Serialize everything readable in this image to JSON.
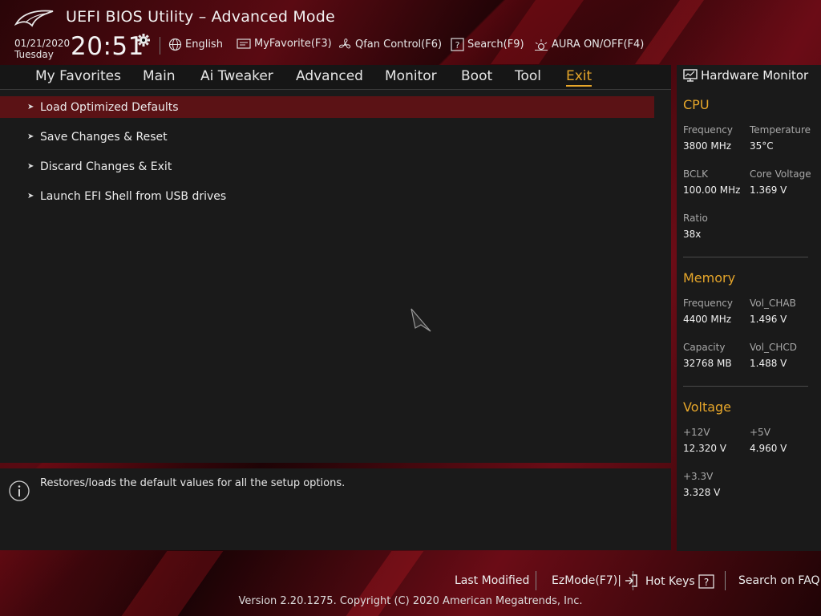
{
  "header": {
    "title": "UEFI BIOS Utility – Advanced Mode",
    "date": "01/21/2020",
    "day": "Tuesday",
    "time": "20:51",
    "tools": [
      {
        "label": "English",
        "icon": "globe-icon"
      },
      {
        "label": "MyFavorite(F3)",
        "icon": "favorite-icon"
      },
      {
        "label": "Qfan Control(F6)",
        "icon": "fan-icon"
      },
      {
        "label": "Search(F9)",
        "icon": "search-help-icon"
      },
      {
        "label": "AURA ON/OFF(F4)",
        "icon": "aura-icon"
      }
    ]
  },
  "tabs": [
    "My Favorites",
    "Main",
    "Ai Tweaker",
    "Advanced",
    "Monitor",
    "Boot",
    "Tool",
    "Exit"
  ],
  "active_tab": "Exit",
  "menu_items": [
    "Load Optimized Defaults",
    "Save Changes & Reset",
    "Discard Changes & Exit",
    "Launch EFI Shell from USB drives"
  ],
  "help_text": "Restores/loads the default values for all the setup options.",
  "hardware_monitor": {
    "title": "Hardware Monitor",
    "cpu": {
      "heading": "CPU",
      "frequency_label": "Frequency",
      "frequency": "3800 MHz",
      "temperature_label": "Temperature",
      "temperature": "35°C",
      "bclk_label": "BCLK",
      "bclk": "100.00 MHz",
      "core_voltage_label": "Core Voltage",
      "core_voltage": "1.369 V",
      "ratio_label": "Ratio",
      "ratio": "38x"
    },
    "memory": {
      "heading": "Memory",
      "frequency_label": "Frequency",
      "frequency": "4400 MHz",
      "vol_chab_label": "Vol_CHAB",
      "vol_chab": "1.496 V",
      "capacity_label": "Capacity",
      "capacity": "32768 MB",
      "vol_chcd_label": "Vol_CHCD",
      "vol_chcd": "1.488 V"
    },
    "voltage": {
      "heading": "Voltage",
      "v12_label": "+12V",
      "v12": "12.320 V",
      "v5_label": "+5V",
      "v5": "4.960 V",
      "v33_label": "+3.3V",
      "v33": "3.328 V"
    }
  },
  "footer": {
    "last_modified": "Last Modified",
    "ezmode": "EzMode(F7)|",
    "hot_keys": "Hot Keys",
    "search_faq": "Search on FAQ",
    "copyright": "Version 2.20.1275. Copyright (C) 2020 American Megatrends, Inc."
  },
  "colors": {
    "accent": "#e6a62a",
    "selected_row": "#5b1215",
    "panel": "#1a1a1a"
  }
}
